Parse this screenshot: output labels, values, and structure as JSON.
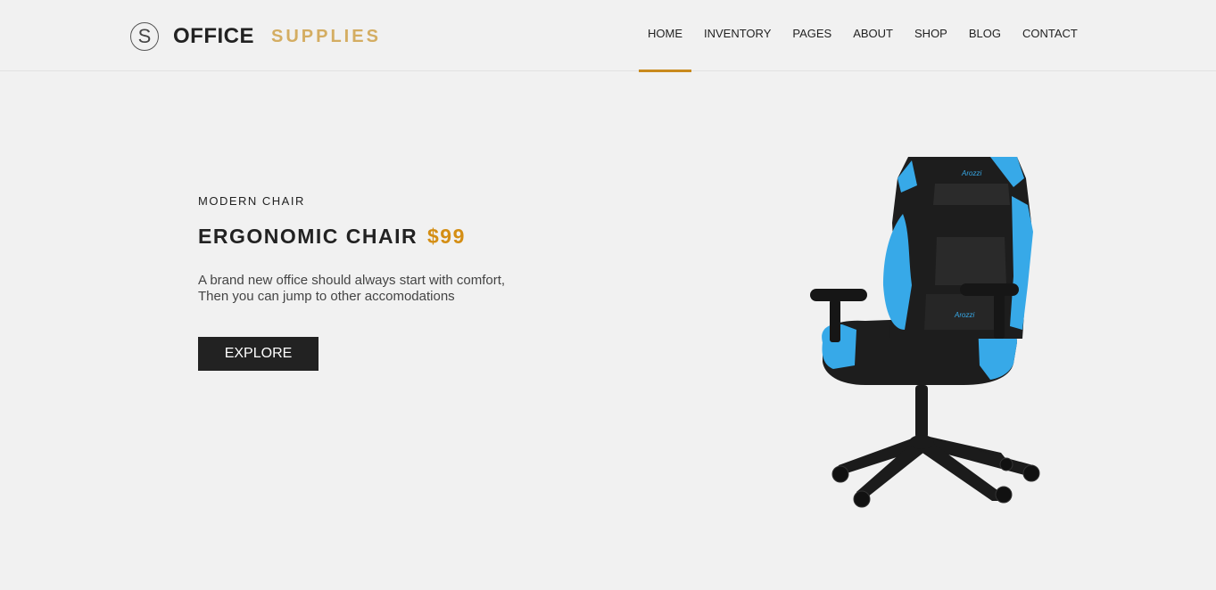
{
  "logo": {
    "letter": "S",
    "word1": "OFFICE",
    "word2": "SUPPLIES"
  },
  "nav": {
    "items": [
      "HOME",
      "INVENTORY",
      "PAGES",
      "ABOUT",
      "SHOP",
      "BLOG",
      "CONTACT"
    ],
    "active": "HOME"
  },
  "hero": {
    "subtitle": "MODERN CHAIR",
    "title": "ERGONOMIC CHAIR",
    "price": "$99",
    "desc_line1": "A brand new office should always start with comfort,",
    "desc_line2": "Then you can jump to other accomodations",
    "button": "EXPLORE"
  },
  "product_image": {
    "brand_text": "Arozzi",
    "colors": {
      "accent": "#37a9e8",
      "body": "#1d1d1d"
    }
  },
  "colors": {
    "background": "#f1f1f1",
    "gold": "#d4ad62",
    "price": "#d48e14",
    "active_underline": "#c98a1d",
    "button_bg": "#222222"
  }
}
